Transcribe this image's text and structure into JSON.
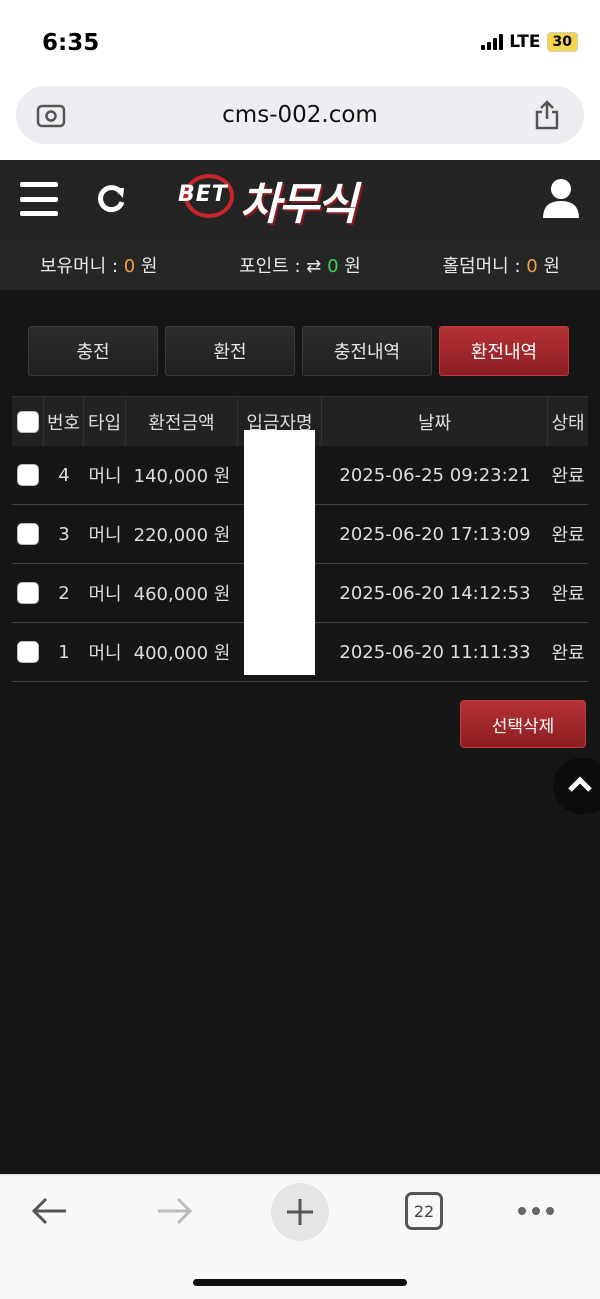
{
  "status_bar": {
    "time": "6:35",
    "network": "LTE",
    "battery": "30"
  },
  "browser": {
    "url": "cms-002.com",
    "tab_count": "22"
  },
  "header": {
    "logo_prefix": "BET",
    "logo_main": "차무식"
  },
  "balances": {
    "holding_label": "보유머니 : ",
    "holding_value": "0",
    "holding_unit": " 원",
    "point_label": "포인트 : ",
    "point_value": "0",
    "point_unit": " 원",
    "holdem_label": "홀덤머니 : ",
    "holdem_value": "0",
    "holdem_unit": " 원"
  },
  "tabs": [
    {
      "label": "충전",
      "active": false
    },
    {
      "label": "환전",
      "active": false
    },
    {
      "label": "충전내역",
      "active": false
    },
    {
      "label": "환전내역",
      "active": true
    }
  ],
  "table": {
    "headers": {
      "no": "번호",
      "type": "타입",
      "amount": "환전금액",
      "name": "입금자명",
      "date": "날짜",
      "status": "상태"
    },
    "rows": [
      {
        "no": "4",
        "type": "머니",
        "amount": "140,000 원",
        "date": "2025-06-25 09:23:21",
        "status": "완료"
      },
      {
        "no": "3",
        "type": "머니",
        "amount": "220,000 원",
        "date": "2025-06-20 17:13:09",
        "status": "완료"
      },
      {
        "no": "2",
        "type": "머니",
        "amount": "460,000 원",
        "date": "2025-06-20 14:12:53",
        "status": "완료"
      },
      {
        "no": "1",
        "type": "머니",
        "amount": "400,000 원",
        "date": "2025-06-20 11:11:33",
        "status": "완료"
      }
    ]
  },
  "actions": {
    "delete_selected": "선택삭제"
  },
  "colors": {
    "accent_red": "#a8282c",
    "balance_orange": "#f0a13a",
    "point_green": "#3ecf5f"
  }
}
